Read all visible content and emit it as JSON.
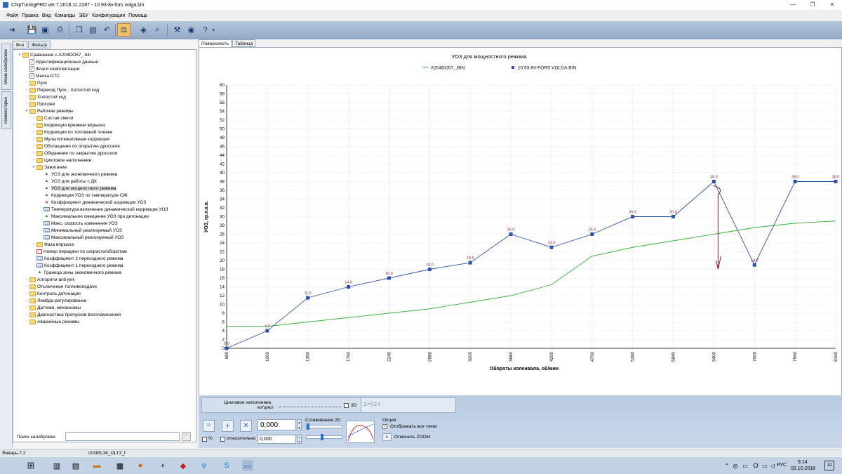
{
  "window": {
    "title": "ChipTuningPRO ver.7.2018.11.2287 - 10.93-8v-fors volga.bin",
    "minimize": "—",
    "maximize": "❐",
    "close": "✕"
  },
  "menu": [
    "Файл",
    "Правка",
    "Вид",
    "Команды",
    "ЭБУ",
    "Конфигурация",
    "Помощь"
  ],
  "sidetabs": [
    "Меню калибровок",
    "Комментарии"
  ],
  "leftpanel": {
    "tabs": [
      "Все",
      "Фильтр"
    ],
    "tree": [
      {
        "label": "Сравнение с A204DO57_.bin",
        "icon": "folder",
        "depth": 0,
        "exp": "v"
      },
      {
        "label": "Идентификационные данные",
        "icon": "doc",
        "depth": 1,
        "exp": ""
      },
      {
        "label": "Флаги комплектации",
        "icon": "doc",
        "depth": 1,
        "exp": ""
      },
      {
        "label": "Маска DTC",
        "icon": "doc",
        "depth": 1,
        "exp": ""
      },
      {
        "label": "Пуск",
        "icon": "folder",
        "depth": 1,
        "exp": ">"
      },
      {
        "label": "Переход Пуск - Холостой ход",
        "icon": "folder",
        "depth": 1,
        "exp": ">"
      },
      {
        "label": "Холостой ход",
        "icon": "folder",
        "depth": 1,
        "exp": ">"
      },
      {
        "label": "Прогрев",
        "icon": "folder",
        "depth": 1,
        "exp": ">"
      },
      {
        "label": "Рабочие режимы",
        "icon": "folder",
        "depth": 1,
        "exp": "v"
      },
      {
        "label": "Состав смеси",
        "icon": "folder",
        "depth": 2,
        "exp": ">"
      },
      {
        "label": "Коррекция времени впрыска",
        "icon": "folder",
        "depth": 2,
        "exp": ">"
      },
      {
        "label": "Коррекция по топливной пленке",
        "icon": "folder",
        "depth": 2,
        "exp": ">"
      },
      {
        "label": "Мультипликативная коррекция",
        "icon": "folder",
        "depth": 2,
        "exp": ">"
      },
      {
        "label": "Обогащение по открытию дросселя",
        "icon": "folder",
        "depth": 2,
        "exp": ">"
      },
      {
        "label": "Обеднение по закрытию дросселя",
        "icon": "folder",
        "depth": 2,
        "exp": ">"
      },
      {
        "label": "Цикловое наполнение",
        "icon": "folder",
        "depth": 2,
        "exp": ">"
      },
      {
        "label": "Зажигание",
        "icon": "folder",
        "depth": 2,
        "exp": "v"
      },
      {
        "label": "УОЗ для экономичного режима",
        "icon": "chart",
        "depth": 3,
        "exp": ""
      },
      {
        "label": "УОЗ для работы с ДК",
        "icon": "chart",
        "depth": 3,
        "exp": ""
      },
      {
        "label": "УОЗ для мощностного режима",
        "icon": "chart",
        "depth": 3,
        "exp": "",
        "selected": true
      },
      {
        "label": "Коррекция УОЗ по температуре ОЖ",
        "icon": "chart",
        "depth": 3,
        "exp": ""
      },
      {
        "label": "Коэффициент динамической коррекции УОЗ",
        "icon": "cross",
        "depth": 3,
        "exp": ""
      },
      {
        "label": "Температура включения динамической коррекции УОЗ",
        "icon": "num",
        "depth": 3,
        "exp": ""
      },
      {
        "label": "Максимальное смещение УОЗ при детонации",
        "icon": "chart",
        "depth": 3,
        "exp": ""
      },
      {
        "label": "Макс. скорость изменения УОЗ",
        "icon": "num",
        "depth": 3,
        "exp": ""
      },
      {
        "label": "Минимальный реализуемый УОЗ",
        "icon": "num",
        "depth": 3,
        "exp": ""
      },
      {
        "label": "Максимальный реализуемый УОЗ",
        "icon": "num",
        "depth": 3,
        "exp": ""
      },
      {
        "label": "Фаза впрыска",
        "icon": "folder",
        "depth": 2,
        "exp": ">"
      },
      {
        "label": "Номер передачи по скорости/оборотам",
        "icon": "table",
        "depth": 2,
        "exp": ""
      },
      {
        "label": "Коэффициент 2 переходного режима",
        "icon": "num",
        "depth": 2,
        "exp": ""
      },
      {
        "label": "Коэффициент 1 переходного режима",
        "icon": "num",
        "depth": 2,
        "exp": ""
      },
      {
        "label": "Граница зоны экономичного режима",
        "icon": "chart",
        "depth": 2,
        "exp": ""
      },
      {
        "label": "Алгоритм anti-jerk",
        "icon": "folder",
        "depth": 1,
        "exp": ">"
      },
      {
        "label": "Отключение топливоподачи",
        "icon": "folder",
        "depth": 1,
        "exp": ">"
      },
      {
        "label": "Контроль детонации",
        "icon": "folder",
        "depth": 1,
        "exp": ">"
      },
      {
        "label": "Лямбда-регулирование",
        "icon": "folder",
        "depth": 1,
        "exp": ">"
      },
      {
        "label": "Датчики, механизмы",
        "icon": "folder",
        "depth": 1,
        "exp": ">"
      },
      {
        "label": "Диагностика пропусков воспламенения",
        "icon": "folder",
        "depth": 1,
        "exp": ">"
      },
      {
        "label": "Аварийные режимы",
        "icon": "folder",
        "depth": 1,
        "exp": ">"
      }
    ],
    "search_label": "Поиск калибровки",
    "search_value": ""
  },
  "main": {
    "tabs": [
      "Поверхность",
      "Таблица"
    ]
  },
  "chart_data": {
    "type": "line",
    "title": "УОЗ для мощностного режима",
    "xlabel": "Обороты коленвала, об/мин",
    "ylabel": "УОЗ, гр.п.к.в.",
    "categories": [
      "680",
      "1000",
      "1360",
      "1760",
      "2240",
      "2680",
      "3200",
      "3680",
      "4200",
      "4760",
      "5280",
      "5840",
      "6400",
      "7000",
      "7560",
      "8160"
    ],
    "ylim": [
      0,
      60
    ],
    "yticks": [
      "0",
      "2",
      "4",
      "6",
      "8",
      "10",
      "12",
      "14",
      "16",
      "18",
      "20",
      "22",
      "24",
      "26",
      "28",
      "30",
      "32",
      "34",
      "36",
      "38",
      "40",
      "42",
      "44",
      "46",
      "48",
      "50",
      "52",
      "54",
      "56",
      "58",
      "60"
    ],
    "grid": true,
    "legend_position": "top-center",
    "series": [
      {
        "name": "A204DO57_.BIN",
        "color": "#3aaa3a",
        "values": [
          5.0,
          5.0,
          6.0,
          7.0,
          8.0,
          9.0,
          10.5,
          12.0,
          14.5,
          21.0,
          23.0,
          24.5,
          26.0,
          27.5,
          28.5,
          29.0
        ]
      },
      {
        "name": "10.93-8V-FORS VOLGA.BIN",
        "color": "#2f52a8",
        "values": [
          0.0,
          4.0,
          11.5,
          14.0,
          16.0,
          18.0,
          19.5,
          26.0,
          23.0,
          26.0,
          30.0,
          30.0,
          38.0,
          19.0,
          38.0,
          38.0
        ],
        "labels": [
          "0.0",
          "4.0",
          "11.5",
          "14.0",
          "16.0",
          "18.0",
          "19.5",
          "26.0",
          "23.0",
          "26.0",
          "30.0",
          "30.0",
          "38.0",
          "19.0",
          "38.0",
          "38.0"
        ]
      }
    ],
    "annotation_color": "#8b1a2a"
  },
  "bottom": {
    "cyc_label": "Цикловое наполнение,",
    "cyc_unit": "мг/цикл",
    "label_3d": "3D",
    "z_readout": "Z=524",
    "value1": "0,000",
    "value2": "0,000",
    "percent_label": "%",
    "relative_label": "относительно",
    "smooth_label": "Сглаживание 2D",
    "options_label": "Опции",
    "show_points_label": "Отображать все точки",
    "cancel_zoom_label": "Отменить ZOOM"
  },
  "status": {
    "left": "Январь-7.2",
    "middle": "I203EL36_OLT3_f"
  },
  "taskbar": {
    "lang": "РУС",
    "time": "9:14",
    "date": "02.10.2018",
    "notif": "19"
  }
}
